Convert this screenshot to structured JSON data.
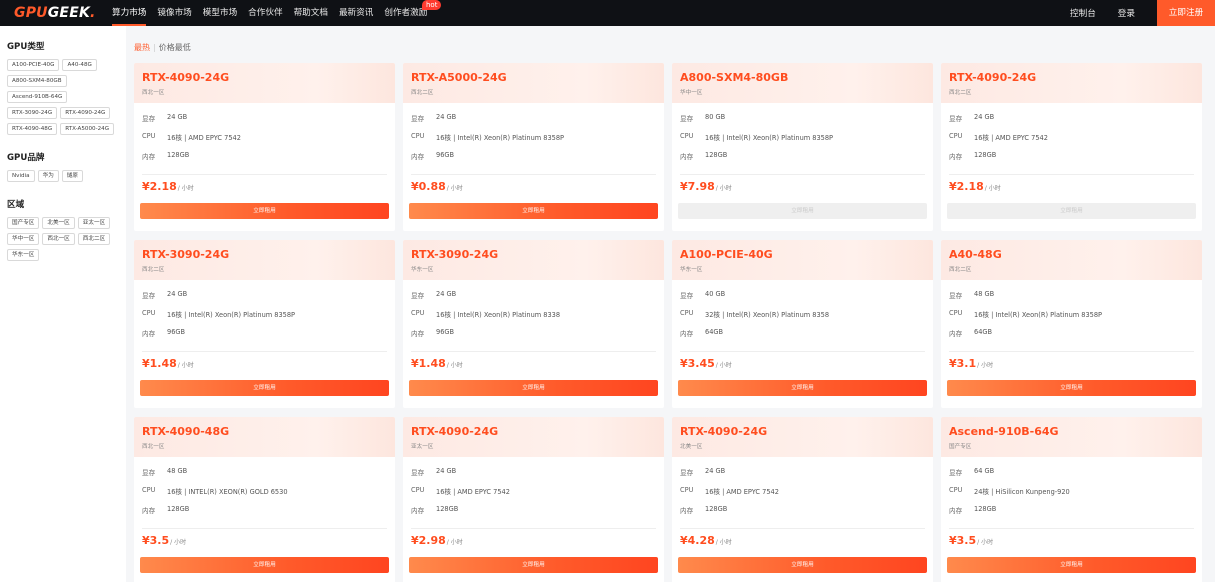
{
  "brand": {
    "logo_red": "GPU",
    "logo_white": "GEEK",
    "logo_dot": "."
  },
  "nav": {
    "items": [
      "算力市场",
      "镜像市场",
      "模型市场",
      "合作伙伴",
      "帮助文档",
      "最新资讯",
      "创作者激励"
    ],
    "hot_badge": "hot",
    "console": "控制台",
    "login": "登录",
    "signup": "立即注册"
  },
  "sidebar": {
    "gpu_type_title": "GPU类型",
    "gpu_types": [
      "A100-PCIE-40G",
      "A40-48G",
      "A800-SXM4-80GB",
      "Ascend-910B-64G",
      "RTX-3090-24G",
      "RTX-4090-24G",
      "RTX-4090-48G",
      "RTX-A5000-24G"
    ],
    "brand_title": "GPU品牌",
    "brands": [
      "Nvidia",
      "华为",
      "燧原"
    ],
    "region_title": "区域",
    "regions": [
      "国产专区",
      "北美一区",
      "亚太一区",
      "华中一区",
      "西北一区",
      "西北二区",
      "华东一区"
    ]
  },
  "sort": {
    "hot": "最热",
    "sep": "|",
    "price": "价格最低"
  },
  "labels": {
    "vram": "显存",
    "cpu": "CPU",
    "ram": "内存",
    "per_hour": "/ 小时",
    "rent": "立即租用"
  },
  "cards": [
    {
      "title": "RTX-4090-24G",
      "region": "西北一区",
      "vram": "24 GB",
      "cpu": "16核 | AMD EPYC 7542",
      "ram": "128GB",
      "price": "¥2.18",
      "available": true
    },
    {
      "title": "RTX-A5000-24G",
      "region": "西北二区",
      "vram": "24 GB",
      "cpu": "16核 | Intel(R) Xeon(R) Platinum 8358P",
      "ram": "96GB",
      "price": "¥0.88",
      "available": true
    },
    {
      "title": "A800-SXM4-80GB",
      "region": "华中一区",
      "vram": "80 GB",
      "cpu": "16核 | Intel(R) Xeon(R) Platinum 8358P",
      "ram": "128GB",
      "price": "¥7.98",
      "available": false
    },
    {
      "title": "RTX-4090-24G",
      "region": "西北二区",
      "vram": "24 GB",
      "cpu": "16核 | AMD EPYC 7542",
      "ram": "128GB",
      "price": "¥2.18",
      "available": false
    },
    {
      "title": "RTX-3090-24G",
      "region": "西北二区",
      "vram": "24 GB",
      "cpu": "16核 | Intel(R) Xeon(R) Platinum 8358P",
      "ram": "96GB",
      "price": "¥1.48",
      "available": true
    },
    {
      "title": "RTX-3090-24G",
      "region": "华东一区",
      "vram": "24 GB",
      "cpu": "16核 | Intel(R) Xeon(R) Platinum 8338",
      "ram": "96GB",
      "price": "¥1.48",
      "available": true
    },
    {
      "title": "A100-PCIE-40G",
      "region": "华东一区",
      "vram": "40 GB",
      "cpu": "32核 | Intel(R) Xeon(R) Platinum 8358",
      "ram": "64GB",
      "price": "¥3.45",
      "available": true
    },
    {
      "title": "A40-48G",
      "region": "西北二区",
      "vram": "48 GB",
      "cpu": "16核 | Intel(R) Xeon(R) Platinum 8358P",
      "ram": "64GB",
      "price": "¥3.1",
      "available": true
    },
    {
      "title": "RTX-4090-48G",
      "region": "西北一区",
      "vram": "48 GB",
      "cpu": "16核 | INTEL(R) XEON(R) GOLD 6530",
      "ram": "128GB",
      "price": "¥3.5",
      "available": true
    },
    {
      "title": "RTX-4090-24G",
      "region": "亚太一区",
      "vram": "24 GB",
      "cpu": "16核 | AMD EPYC 7542",
      "ram": "128GB",
      "price": "¥2.98",
      "available": true
    },
    {
      "title": "RTX-4090-24G",
      "region": "北美一区",
      "vram": "24 GB",
      "cpu": "16核 | AMD EPYC 7542",
      "ram": "128GB",
      "price": "¥4.28",
      "available": true
    },
    {
      "title": "Ascend-910B-64G",
      "region": "国产专区",
      "vram": "64 GB",
      "cpu": "24核 | HiSilicon Kunpeng-920",
      "ram": "128GB",
      "price": "¥3.5",
      "available": true
    }
  ],
  "colors": {
    "accent": "#ff5a2a",
    "nav_bg": "#0f1115",
    "price": "#ff4d1f"
  }
}
